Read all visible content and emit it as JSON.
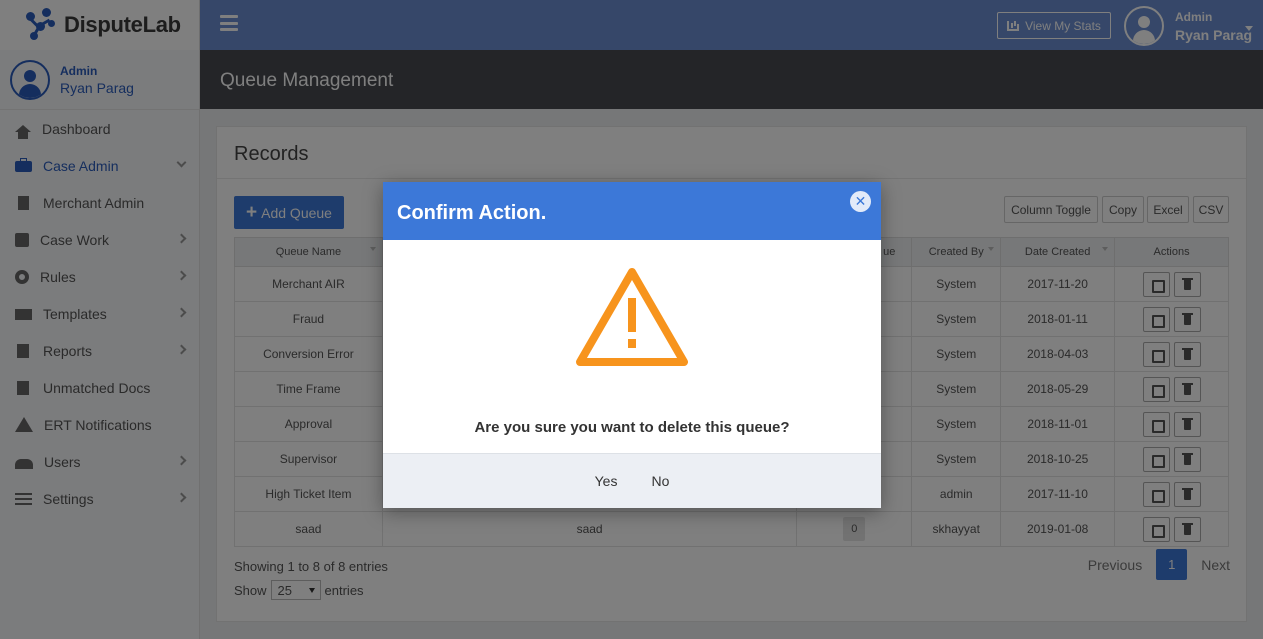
{
  "brand": {
    "name": "DisputeLab"
  },
  "topbar": {
    "stats_label": "View My Stats",
    "user_role": "Admin",
    "user_name": "Ryan Parag"
  },
  "sidebar": {
    "user_role": "Admin",
    "user_name": "Ryan Parag",
    "items": [
      {
        "label": "Dashboard",
        "icon": "home-icon"
      },
      {
        "label": "Case Admin",
        "icon": "briefcase-icon"
      },
      {
        "label": "Merchant Admin",
        "icon": "building-icon"
      },
      {
        "label": "Case Work",
        "icon": "edit-icon"
      },
      {
        "label": "Rules",
        "icon": "gear-icon"
      },
      {
        "label": "Templates",
        "icon": "envelope-icon"
      },
      {
        "label": "Reports",
        "icon": "document-icon"
      },
      {
        "label": "Unmatched Docs",
        "icon": "file-plus-icon"
      },
      {
        "label": "ERT Notifications",
        "icon": "warning-icon"
      },
      {
        "label": "Users",
        "icon": "users-icon"
      },
      {
        "label": "Settings",
        "icon": "sliders-icon"
      }
    ]
  },
  "page": {
    "title": "Queue Management"
  },
  "records": {
    "title": "Records",
    "add_label": "Add Queue",
    "tools": [
      "Column Toggle",
      "Copy",
      "Excel",
      "CSV"
    ],
    "columns": [
      "Queue Name",
      "",
      "",
      "ue",
      "Created By",
      "Date Created",
      "Actions"
    ],
    "rows": [
      {
        "name": "Merchant AIR",
        "description": "",
        "count": "",
        "created_by": "System",
        "date": "2017-11-20"
      },
      {
        "name": "Fraud",
        "description": "",
        "count": "",
        "created_by": "System",
        "date": "2018-01-11"
      },
      {
        "name": "Conversion Error",
        "description": "",
        "count": "",
        "created_by": "System",
        "date": "2018-04-03"
      },
      {
        "name": "Time Frame",
        "description": "",
        "count": "",
        "created_by": "System",
        "date": "2018-05-29"
      },
      {
        "name": "Approval",
        "description": "",
        "count": "",
        "created_by": "System",
        "date": "2018-11-01"
      },
      {
        "name": "Supervisor",
        "description": "",
        "count": "",
        "created_by": "System",
        "date": "2018-10-25"
      },
      {
        "name": "High Ticket Item",
        "description": "",
        "count": "",
        "created_by": "admin",
        "date": "2017-11-10"
      },
      {
        "name": "saad",
        "description": "saad",
        "count": "0",
        "created_by": "skhayyat",
        "date": "2019-01-08"
      }
    ],
    "showing": "Showing 1 to 8 of 8 entries",
    "show_prefix": "Show",
    "show_value": "25",
    "show_suffix": "entries",
    "pager": {
      "previous": "Previous",
      "page": "1",
      "next": "Next"
    }
  },
  "modal": {
    "title": "Confirm Action.",
    "message": "Are you sure you want to delete this queue?",
    "yes": "Yes",
    "no": "No",
    "accent": "#3c78d8",
    "warning_color": "#f7941d"
  }
}
